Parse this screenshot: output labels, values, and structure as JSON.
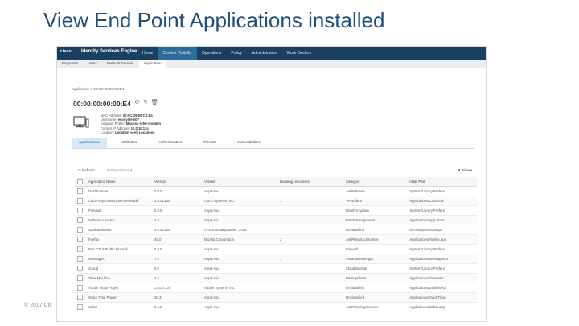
{
  "slide": {
    "title": "View End Point Applications installed",
    "footer": "© 2017 Cis"
  },
  "app": {
    "logo": "cisco",
    "product": "Identity Services Engine",
    "nav": [
      "Home",
      "Context Visibility",
      "Operations",
      "Policy",
      "Administration",
      "Work Centers"
    ],
    "subnav": [
      "Endpoints",
      "Users",
      "Network Devices",
      "Application"
    ]
  },
  "breadcrumb": {
    "link": "Application",
    "separator": ">",
    "current": "00:0C:29:00:C0:E4"
  },
  "endpoint": {
    "mac_title": "00:00:00:00:00:E4",
    "details": [
      {
        "label": "MAC Address:",
        "value": "00:0C:29:00:C0:E4"
      },
      {
        "label": "Username:",
        "value": "ecosystem07"
      },
      {
        "label": "Endpoint Profile:",
        "value": "Macosx-refer-lesnikm"
      },
      {
        "label": "Current IP Address:",
        "value": "10.0.10.12s"
      },
      {
        "label": "Location:",
        "value": "Location ➔ All Locations"
      }
    ]
  },
  "tabs": [
    "Applications",
    "Attributes",
    "Authentication",
    "Threats",
    "Vulnerabilities"
  ],
  "table_toolbar": {
    "refresh": "⟳ Refresh",
    "policy_actions": "Policy Actions ▾",
    "filter": "▼ Filter▾"
  },
  "table": {
    "columns": [
      "",
      "Application Name",
      "Version",
      "Vendor",
      "Running processes",
      "Category",
      "Install Path"
    ],
    "rows": [
      [
        "Dashboarder",
        "0.0.5",
        "Apple Inc.",
        "",
        "AntiMalware",
        "/System/Library/Prefere"
      ],
      [
        "Cisco AnyConnect Secure Mobili",
        "1.4.01354",
        "Cisco Systems, Inc.",
        "1",
        "VPNClient",
        "/Applications/Cisco/Cis"
      ],
      [
        "FileVault",
        "0.0.5",
        "Apple Inc.",
        "",
        "DiskEncryption",
        "/System/Library/Prefere"
      ],
      [
        "Software Update",
        "2.3",
        "Apple Inc.",
        "",
        "PatchManagement",
        "/Applications/App Store"
      ],
      [
        "cpsdownloader",
        "0.4.01354",
        "VPLocompanyName , 2026",
        "",
        "Unclassified",
        "/cisco/anyconnect/vpn"
      ],
      [
        "Firefox",
        "49.0",
        "Mozilla Corporation",
        "2",
        "AntiPhishing,Browser",
        "/Applications/Firefox.app"
      ],
      [
        "Mac OS X Builtin Firewall",
        "0.0.5",
        "Apple Inc.",
        "",
        "Firewall",
        "/System/Library/Prefere"
      ],
      [
        "Messages",
        "7.0",
        "Apple Inc.",
        "1",
        "InstantMessenger",
        "/Applications/Messages.a"
      ],
      [
        "iCloud",
        "5.0",
        "Apple Inc.",
        "",
        "CloudStorage",
        "/System/Library/Prefere"
      ],
      [
        "Time Machine",
        "2.5",
        "Apple Inc.",
        "",
        "BackupClient",
        "/Applications/Time Mac"
      ],
      [
        "Adobe Flash Player",
        "17.0.0.134",
        "Adobe Systems Inc.",
        "",
        "Unclassified",
        "/Applications/Utilities/Ad"
      ],
      [
        "Quick Time Player",
        "10.3",
        "Apple Inc.",
        "",
        "Unclassified",
        "/Applications/QuickTime"
      ],
      [
        "Safari",
        "9.1.2",
        "Apple Inc.",
        "",
        "AntiPhishing,Browser",
        "/Applications/Safari.app"
      ]
    ]
  }
}
